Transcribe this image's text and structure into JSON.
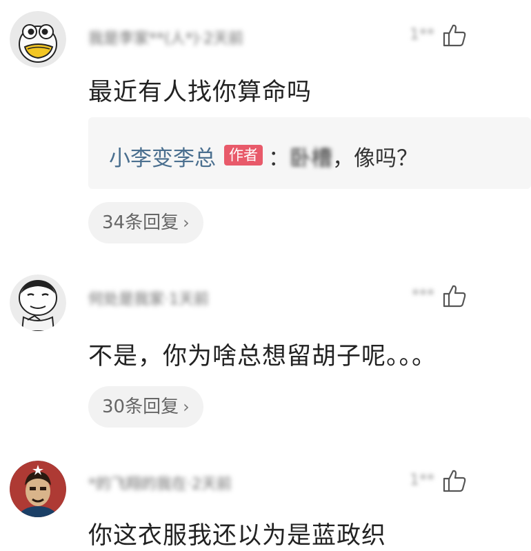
{
  "comments": [
    {
      "username": "我是李家**(人*)·2天前",
      "likes": "1**",
      "text": "最近有人找你算命吗",
      "reply_preview": {
        "author": "小李变李总",
        "badge": "作者",
        "colon": "：",
        "blurred": "卧槽",
        "text": "，像吗？"
      },
      "replies_label": "34条回复",
      "replies_chevron": "›"
    },
    {
      "username": "何处是我家·1天前",
      "likes": "***",
      "text": "不是，你为啥总想留胡子呢。。。",
      "replies_label": "30条回复",
      "replies_chevron": "›"
    },
    {
      "username": "*的飞翔的我在·2天前",
      "likes": "1**",
      "text": "你这衣服我还以为是蓝政织"
    }
  ],
  "icons": {
    "like": "thumbs-up-icon"
  }
}
